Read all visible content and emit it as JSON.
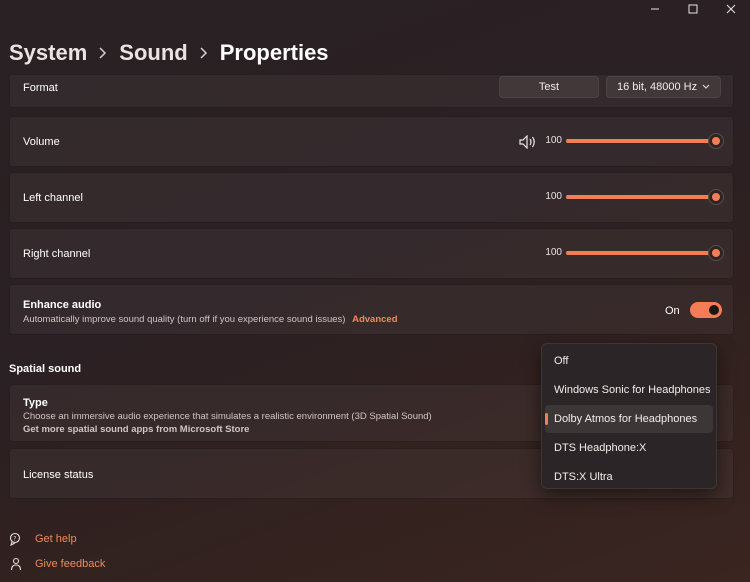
{
  "breadcrumb": {
    "items": [
      "System",
      "Sound",
      "Properties"
    ]
  },
  "format": {
    "label": "Format",
    "test_button": "Test",
    "format_value": "16 bit, 48000 Hz"
  },
  "volume": {
    "label": "Volume",
    "value": "100",
    "level": 1.0
  },
  "left_channel": {
    "label": "Left channel",
    "value": "100",
    "level": 1.0
  },
  "right_channel": {
    "label": "Right channel",
    "value": "100",
    "level": 1.0
  },
  "enhance_audio": {
    "label": "Enhance audio",
    "description": "Automatically improve sound quality (turn off if you experience sound issues)",
    "link": "Advanced",
    "toggle_state": "On"
  },
  "spatial_sound": {
    "header": "Spatial sound",
    "type_label": "Type",
    "type_description": "Choose an immersive audio experience that simulates a realistic environment (3D Spatial Sound)",
    "type_link": "Get more spatial sound apps from Microsoft Store",
    "license_label": "License status",
    "options": [
      "Off",
      "Windows Sonic for Headphones",
      "Dolby Atmos for Headphones",
      "DTS Headphone:X",
      "DTS:X Ultra"
    ],
    "selected_option": "Dolby Atmos for Headphones"
  },
  "footer": {
    "get_help": "Get help",
    "give_feedback": "Give feedback"
  },
  "colors": {
    "accent": "#f47d55",
    "link": "#f08a5d"
  }
}
